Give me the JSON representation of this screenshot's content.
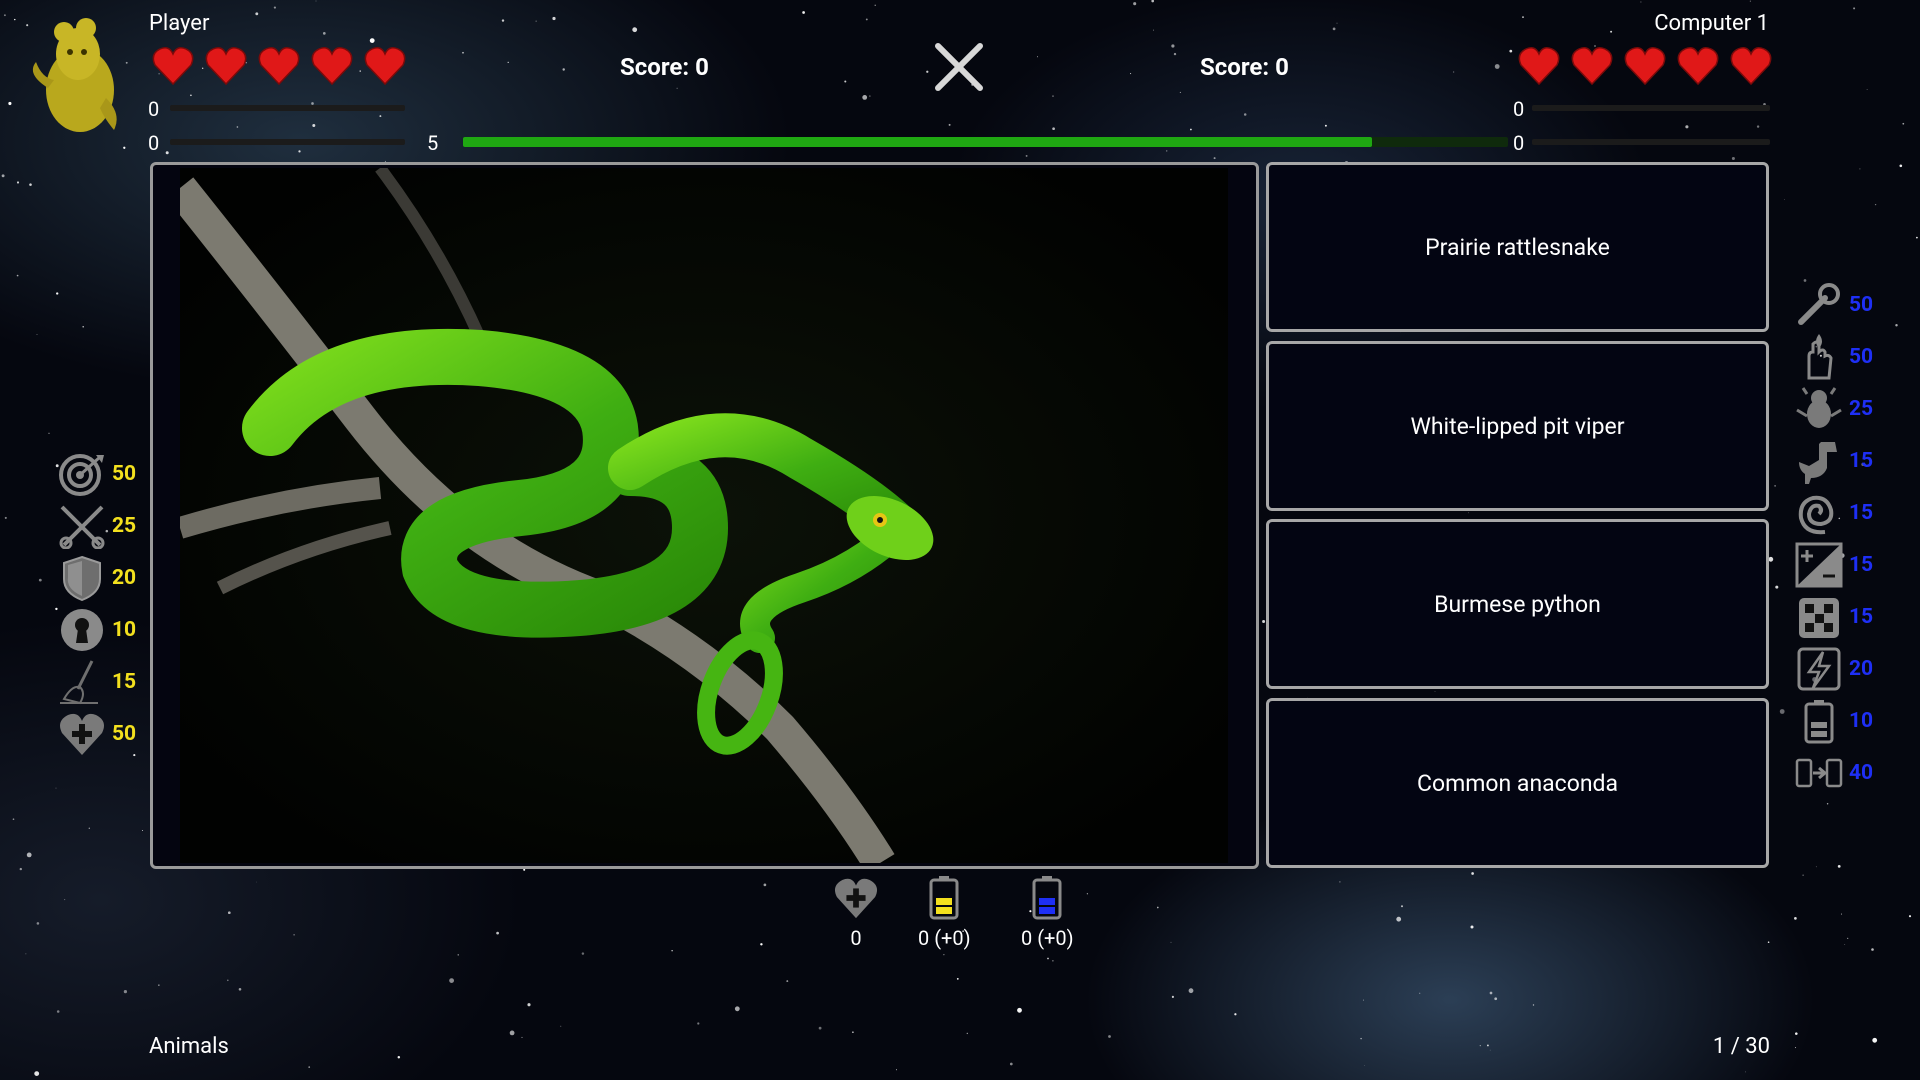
{
  "player": {
    "name": "Player",
    "score_label": "Score: 0",
    "lives": 5,
    "bar1_value": "0",
    "bar2_value": "0"
  },
  "opponent": {
    "name": "Computer 1",
    "score_label": "Score: 0",
    "lives": 5,
    "bar1_value": "0",
    "bar2_value": "0"
  },
  "timer": {
    "value": "5",
    "progress": 0.87,
    "color": "#1fa712"
  },
  "question": {
    "image_description_icon": "green-pit-viper-photo",
    "answers": [
      "Prairie rattlesnake",
      "White-lipped pit viper",
      "Burmese python",
      "Common anaconda"
    ]
  },
  "left_powerups": [
    {
      "icon": "target-icon",
      "value": "50"
    },
    {
      "icon": "crossed-swords-icon",
      "value": "25"
    },
    {
      "icon": "shield-icon",
      "value": "20"
    },
    {
      "icon": "keyhole-icon",
      "value": "10"
    },
    {
      "icon": "broom-icon",
      "value": "15"
    },
    {
      "icon": "heart-plus-icon",
      "value": "50"
    }
  ],
  "right_powerups": [
    {
      "icon": "wrench-icon",
      "value": "50"
    },
    {
      "icon": "hand-flame-icon",
      "value": "50"
    },
    {
      "icon": "creature-icon",
      "value": "25"
    },
    {
      "icon": "dinosaur-icon",
      "value": "15"
    },
    {
      "icon": "spiral-icon",
      "value": "15"
    },
    {
      "icon": "plus-minus-icon",
      "value": "15"
    },
    {
      "icon": "dice-icon",
      "value": "15"
    },
    {
      "icon": "lightning-icon",
      "value": "20"
    },
    {
      "icon": "battery-icon",
      "value": "10"
    },
    {
      "icon": "battery-transfer-icon",
      "value": "40"
    }
  ],
  "inventory": {
    "hearts": "0",
    "yellow_battery": "0 (+0)",
    "blue_battery": "0 (+0)"
  },
  "footer": {
    "category": "Animals",
    "progress": "1 / 30"
  },
  "colors": {
    "accent_yellow": "#f3e01e",
    "accent_blue": "#1e2ff5",
    "heart_red": "#e01818"
  }
}
